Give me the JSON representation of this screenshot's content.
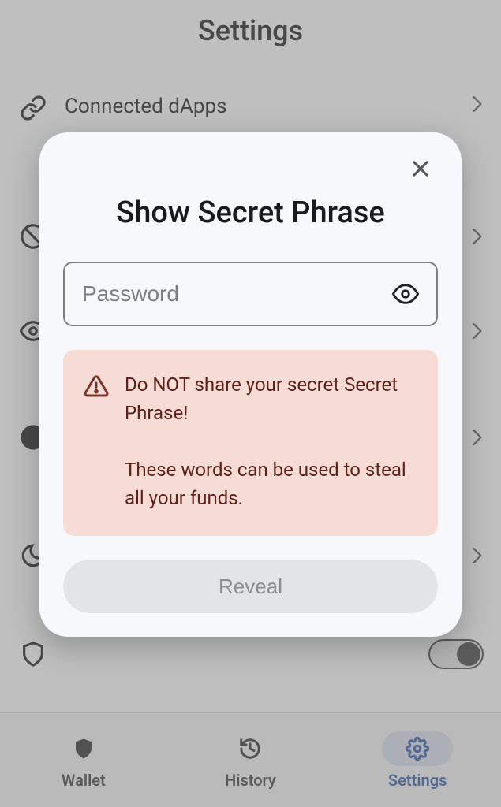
{
  "page": {
    "title": "Settings"
  },
  "settings": {
    "items": [
      {
        "label": "Connected dApps"
      }
    ]
  },
  "bottomNav": {
    "wallet": "Wallet",
    "history": "History",
    "settings": "Settings"
  },
  "modal": {
    "title": "Show Secret Phrase",
    "password_placeholder": "Password",
    "warning_line1": "Do NOT share your secret Secret Phrase!",
    "warning_line2": "These words can be used to steal all your funds.",
    "reveal_label": "Reveal"
  }
}
